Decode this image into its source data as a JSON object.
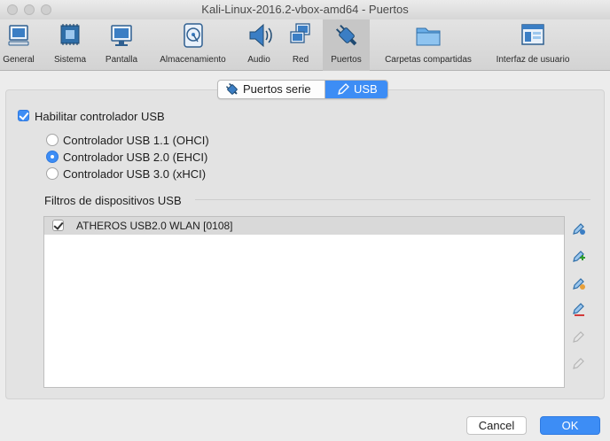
{
  "window": {
    "title": "Kali-Linux-2016.2-vbox-amd64 - Puertos"
  },
  "toolbar": {
    "items": [
      {
        "label": "General",
        "icon": "monitor-general-icon"
      },
      {
        "label": "Sistema",
        "icon": "chip-icon"
      },
      {
        "label": "Pantalla",
        "icon": "display-icon"
      },
      {
        "label": "Almacenamiento",
        "icon": "disk-icon"
      },
      {
        "label": "Audio",
        "icon": "speaker-icon"
      },
      {
        "label": "Red",
        "icon": "network-icon"
      },
      {
        "label": "Puertos",
        "icon": "plug-icon"
      },
      {
        "label": "Carpetas compartidas",
        "icon": "folder-icon"
      },
      {
        "label": "Interfaz de usuario",
        "icon": "window-ui-icon"
      }
    ],
    "active": "Puertos"
  },
  "tabs": [
    {
      "label": "Puertos serie"
    },
    {
      "label": "USB"
    }
  ],
  "usb": {
    "enable_label": "Habilitar controlador USB",
    "enabled": true,
    "controllers": [
      {
        "label": "Controlador USB 1.1 (OHCI)",
        "selected": false
      },
      {
        "label": "Controlador USB 2.0 (EHCI)",
        "selected": true
      },
      {
        "label": "Controlador USB 3.0 (xHCI)",
        "selected": false
      }
    ],
    "filters_label": "Filtros de dispositivos USB",
    "filters": [
      {
        "name": "ATHEROS USB2.0 WLAN [0108]",
        "checked": true
      }
    ]
  },
  "side_actions": [
    {
      "icon": "usb-add-empty-filter-icon",
      "enabled": true
    },
    {
      "icon": "usb-add-from-device-icon",
      "enabled": true
    },
    {
      "icon": "usb-edit-filter-icon",
      "enabled": true
    },
    {
      "icon": "usb-remove-filter-icon",
      "enabled": true
    },
    {
      "icon": "usb-move-up-icon",
      "enabled": false
    },
    {
      "icon": "usb-move-down-icon",
      "enabled": false
    }
  ],
  "buttons": {
    "cancel": "Cancel",
    "ok": "OK"
  },
  "colors": {
    "accent": "#3d8df5",
    "toolbar_icon": "#3b7ec4"
  }
}
